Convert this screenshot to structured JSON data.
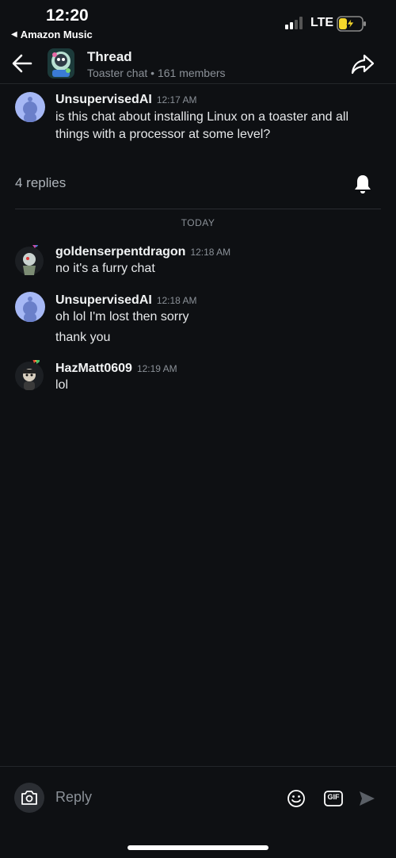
{
  "status_bar": {
    "time": "12:20",
    "back_app": "Amazon Music",
    "network": "LTE"
  },
  "header": {
    "title": "Thread",
    "subtitle": "Toaster chat • 161 members"
  },
  "root_message": {
    "author": "UnsupervisedAI",
    "time": "12:17 AM",
    "text": "is this chat about installing Linux on a toaster and all things with a processor at some level?"
  },
  "replies": {
    "count_label": "4 replies",
    "day_label": "TODAY"
  },
  "messages": [
    {
      "author": "goldenserpentdragon",
      "time": "12:18 AM",
      "lines": [
        "no it's a furry chat"
      ]
    },
    {
      "author": "UnsupervisedAI",
      "time": "12:18 AM",
      "lines": [
        "oh lol I'm lost then sorry",
        "thank you"
      ]
    },
    {
      "author": "HazMatt0609",
      "time": "12:19 AM",
      "lines": [
        "lol"
      ]
    }
  ],
  "composer": {
    "placeholder": "Reply",
    "gif_label": "GIF"
  },
  "icons": {
    "back": "arrow-left-icon",
    "share": "share-icon",
    "bell": "bell-icon",
    "camera": "camera-icon",
    "emoji": "emoji-icon",
    "gif": "gif-icon",
    "send": "send-icon"
  },
  "colors": {
    "background": "#0e1013",
    "avatar_blue": "#a6b8f5",
    "text_primary": "#f1f3f4",
    "text_secondary": "#8b9198"
  }
}
